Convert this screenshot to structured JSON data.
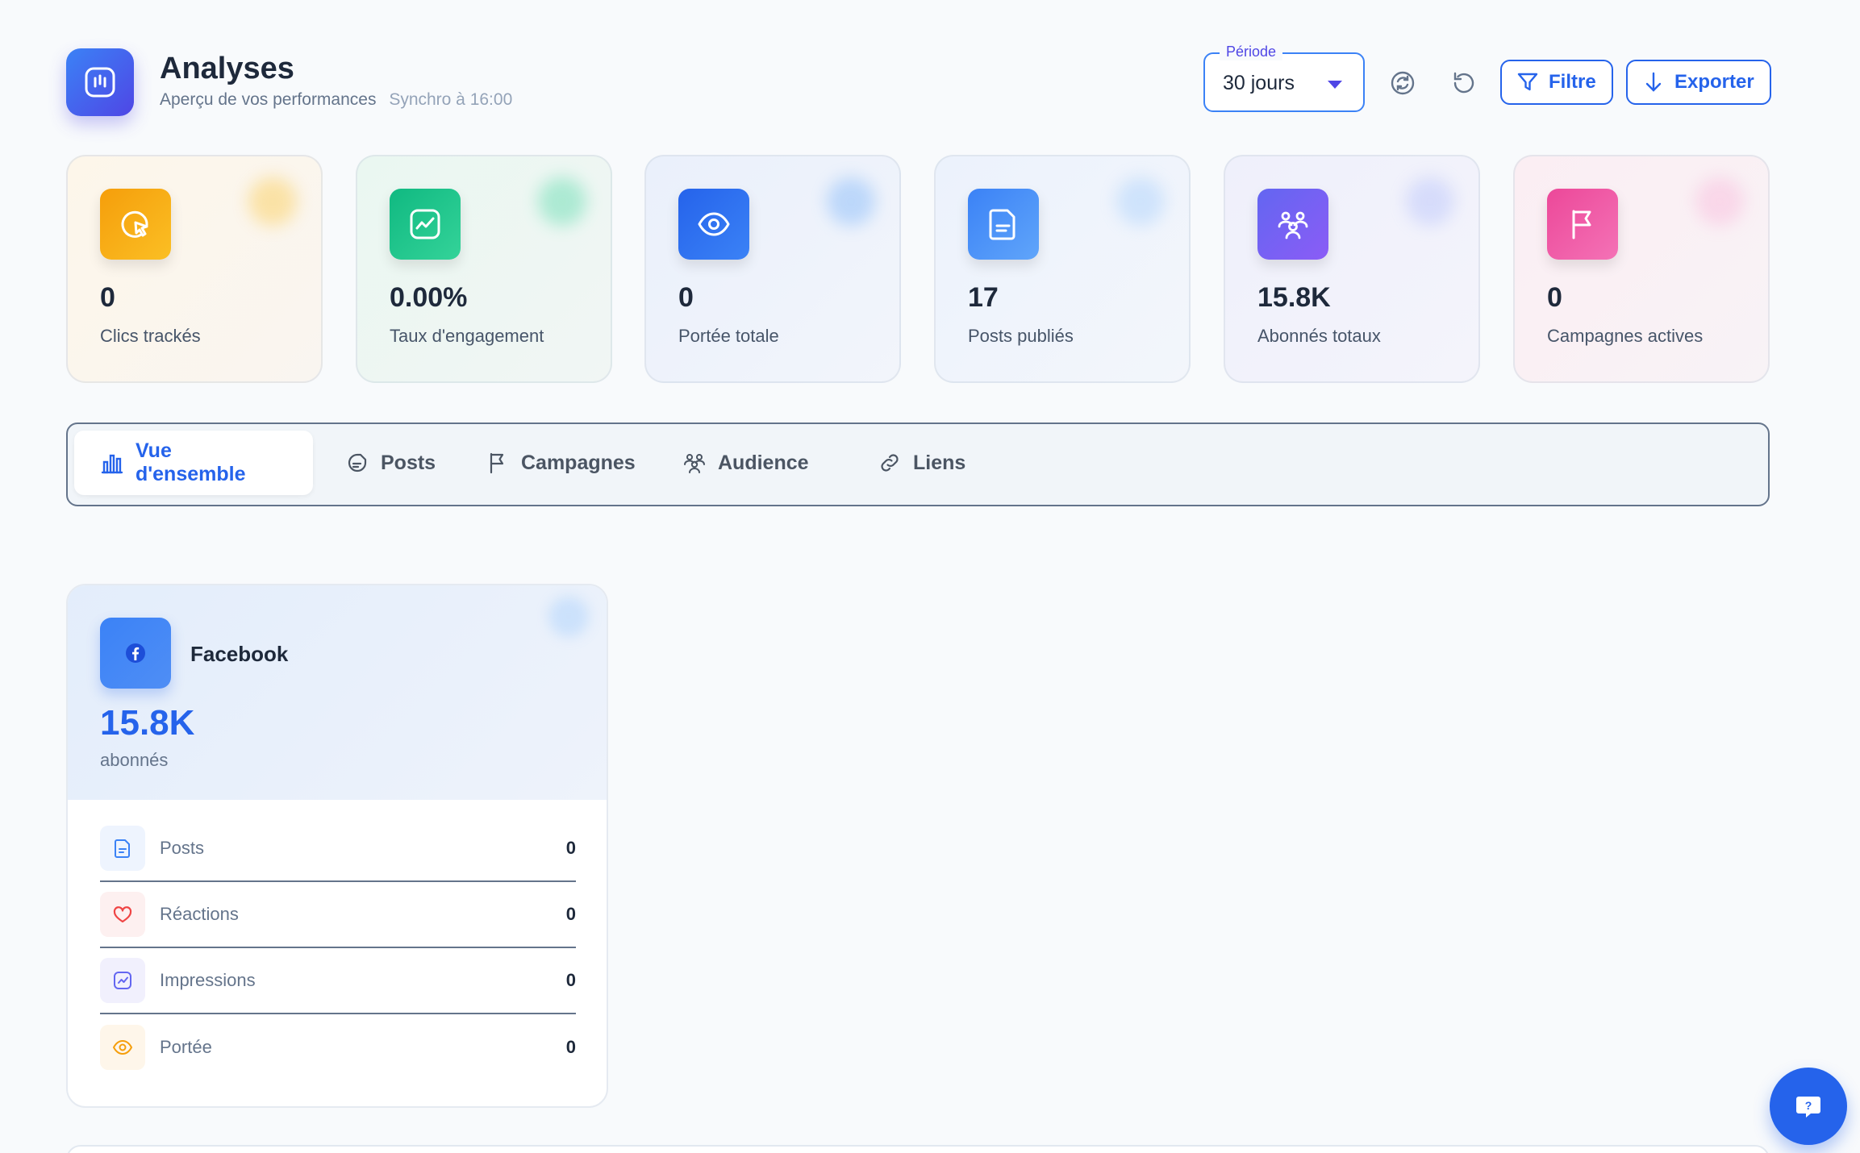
{
  "header": {
    "title": "Analyses",
    "subtitle": "Aperçu de vos performances",
    "sync": "Synchro à 16:00",
    "period": {
      "label": "Période",
      "value": "30 jours"
    },
    "filter_label": "Filtre",
    "export_label": "Exporter"
  },
  "stats": [
    {
      "value": "0",
      "label": "Clics trackés",
      "icon": "cursor-click-icon",
      "color": "#f59e0b"
    },
    {
      "value": "0.00%",
      "label": "Taux d'engagement",
      "icon": "trend-chart-icon",
      "color": "#10b981"
    },
    {
      "value": "0",
      "label": "Portée totale",
      "icon": "eye-icon",
      "color": "#2563eb"
    },
    {
      "value": "17",
      "label": "Posts publiés",
      "icon": "document-icon",
      "color": "#3b82f6"
    },
    {
      "value": "15.8K",
      "label": "Abonnés totaux",
      "icon": "users-icon",
      "color": "#6366f1"
    },
    {
      "value": "0",
      "label": "Campagnes actives",
      "icon": "flag-icon",
      "color": "#ec4899"
    }
  ],
  "tabs": [
    {
      "label": "Vue d'ensemble",
      "icon": "bar-chart-icon",
      "active": true
    },
    {
      "label": "Posts",
      "icon": "document-icon",
      "active": false
    },
    {
      "label": "Campagnes",
      "icon": "flag-icon",
      "active": false
    },
    {
      "label": "Audience",
      "icon": "users-icon",
      "active": false
    },
    {
      "label": "Liens",
      "icon": "link-icon",
      "active": false
    }
  ],
  "platform": {
    "name": "Facebook",
    "count": "15.8K",
    "unit": "abonnés",
    "metrics": [
      {
        "label": "Posts",
        "value": "0",
        "icon": "document-icon",
        "color": "#3b82f6"
      },
      {
        "label": "Réactions",
        "value": "0",
        "icon": "heart-icon",
        "color": "#ef4444"
      },
      {
        "label": "Impressions",
        "value": "0",
        "icon": "trend-chart-icon",
        "color": "#6366f1"
      },
      {
        "label": "Portée",
        "value": "0",
        "icon": "eye-icon",
        "color": "#f59e0b"
      }
    ]
  },
  "help": {
    "icon": "help-chat-icon"
  }
}
